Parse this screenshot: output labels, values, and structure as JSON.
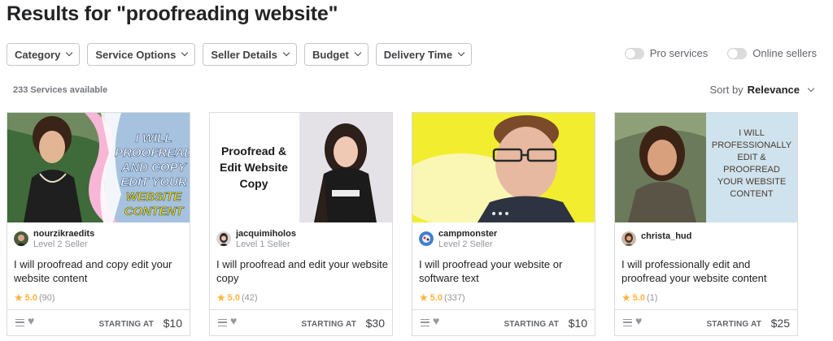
{
  "page": {
    "title": "Results for \"proofreading website\""
  },
  "filters": [
    {
      "label": "Category"
    },
    {
      "label": "Service Options"
    },
    {
      "label": "Seller Details"
    },
    {
      "label": "Budget"
    },
    {
      "label": "Delivery Time"
    }
  ],
  "toggles": {
    "pro": "Pro services",
    "online": "Online sellers"
  },
  "results": {
    "count": "233 Services available"
  },
  "sort": {
    "label": "Sort by",
    "value": "Relevance"
  },
  "colors": {
    "star": "#ffb33e",
    "text": "#222325",
    "muted": "#95979d",
    "border": "#dadbdd"
  },
  "cards": [
    {
      "seller": "nourzikraedits",
      "level": "Level 2 Seller",
      "title": "I will proofread and copy edit your website content",
      "rating": "5.0",
      "reviews": "(90)",
      "starting": "STARTING AT",
      "price": "$10",
      "image_text": [
        "I WILL",
        "PROOFREAD",
        "AND COPY",
        "EDIT YOUR",
        "WEBSITE",
        "CONTENT"
      ]
    },
    {
      "seller": "jacquimiholos",
      "level": "Level 1 Seller",
      "title": "I will proofread and edit your website copy",
      "rating": "5.0",
      "reviews": "(42)",
      "starting": "STARTING AT",
      "price": "$30",
      "image_text": [
        "Proofread &",
        "Edit Website",
        "Copy"
      ]
    },
    {
      "seller": "campmonster",
      "level": "Level 2 Seller",
      "title": "I will proofread your website or software text",
      "rating": "5.0",
      "reviews": "(337)",
      "starting": "STARTING AT",
      "price": "$10"
    },
    {
      "seller": "christa_hud",
      "level": "",
      "title": "I will professionally edit and proofread your website content",
      "rating": "5.0",
      "reviews": "(1)",
      "starting": "STARTING AT",
      "price": "$25",
      "image_text": [
        "I WILL",
        "PROFESSIONALLY",
        "EDIT &",
        "PROOFREAD",
        "YOUR WEBSITE",
        "CONTENT"
      ]
    }
  ]
}
